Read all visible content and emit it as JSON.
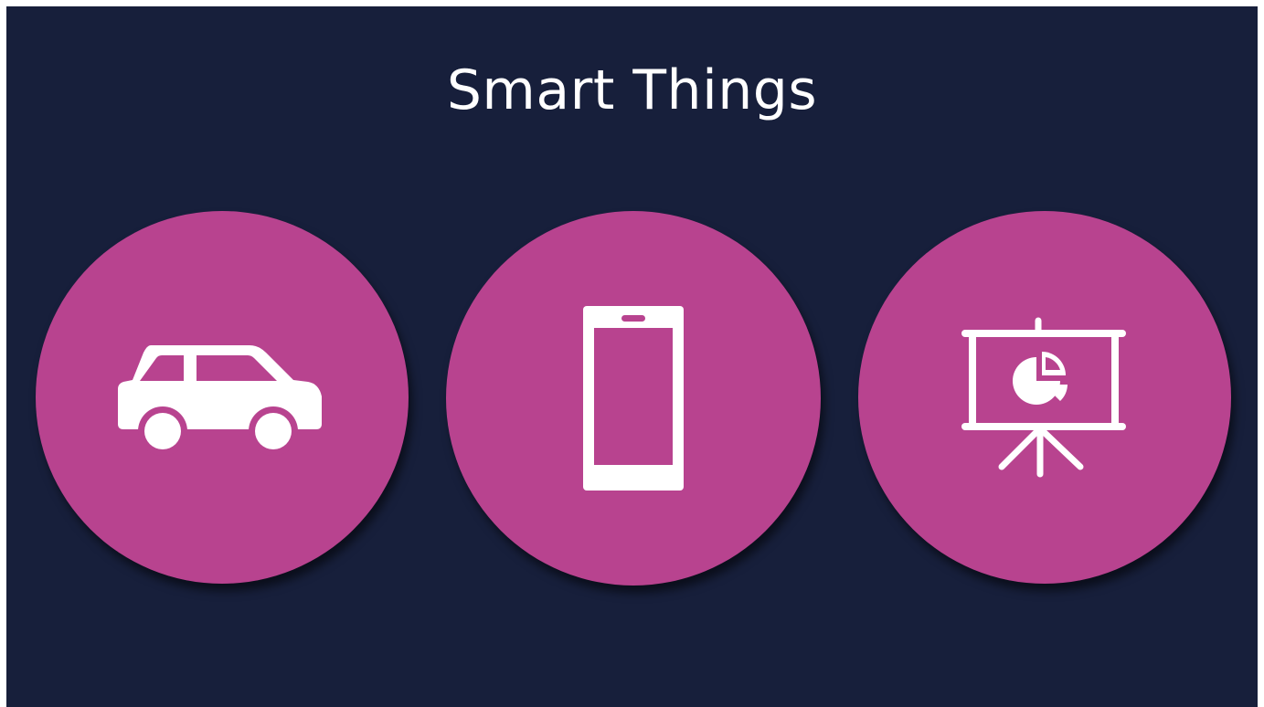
{
  "title": "Smart Things",
  "colors": {
    "background": "#171f3b",
    "circle": "#b8438f",
    "icon": "#ffffff",
    "frame": "#ffffff"
  },
  "items": [
    {
      "icon": "car-icon"
    },
    {
      "icon": "smartphone-icon"
    },
    {
      "icon": "presentation-chart-icon"
    }
  ]
}
